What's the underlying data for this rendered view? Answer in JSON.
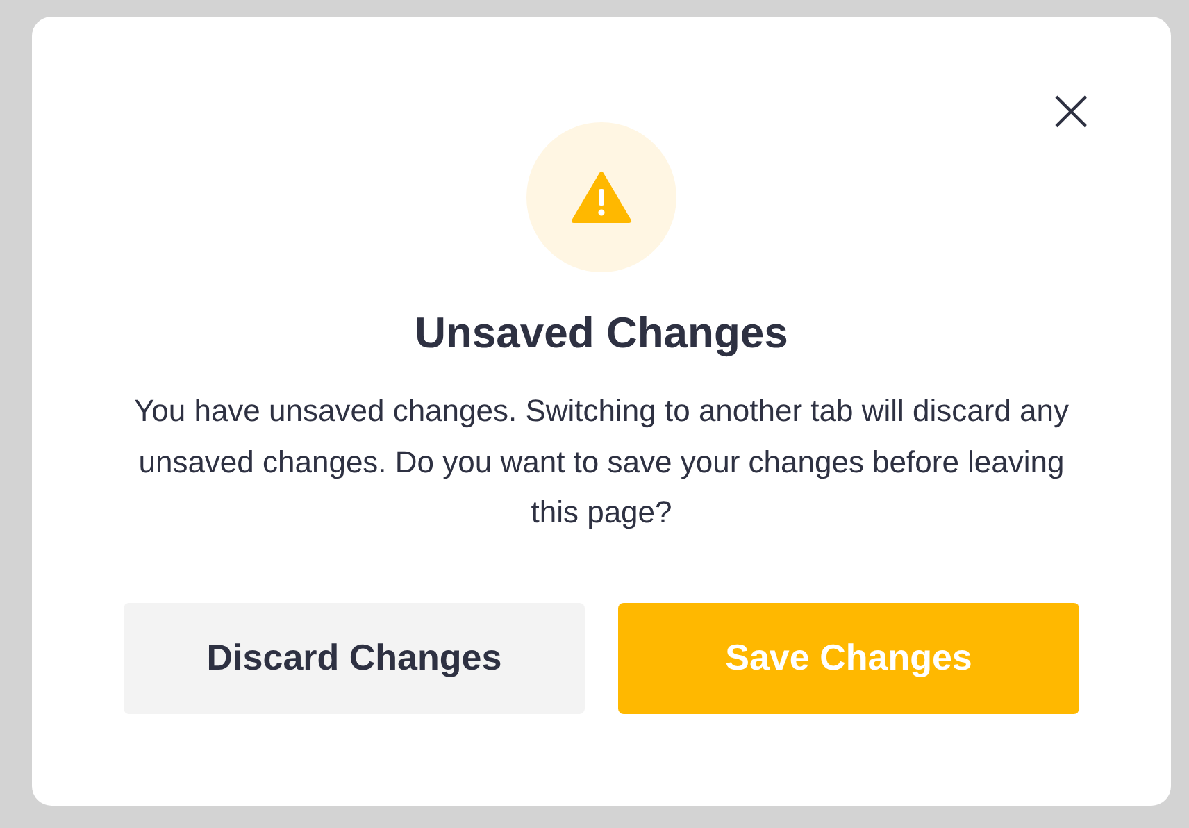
{
  "dialog": {
    "close_label": "×",
    "title": "Unsaved Changes",
    "message": "You have unsaved changes. Switching to another tab will discard any unsaved changes. Do you want to save your changes before leaving this page?",
    "buttons": [
      {
        "label": "Discard Changes",
        "kind": "secondary"
      },
      {
        "label": "Save Changes",
        "kind": "primary"
      }
    ]
  }
}
